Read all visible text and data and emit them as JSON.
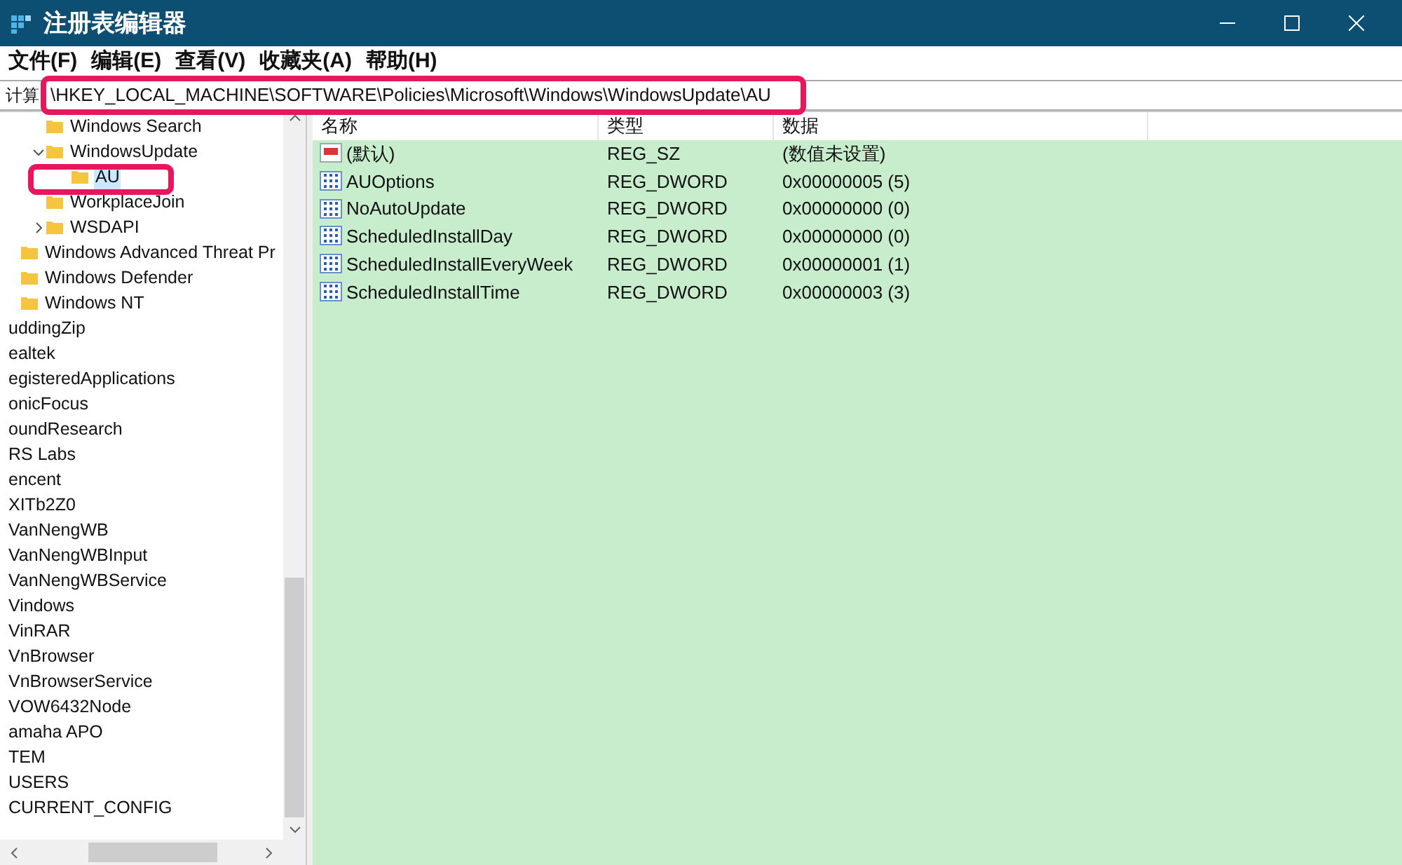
{
  "window": {
    "title": "注册表编辑器"
  },
  "menu": [
    "文件(F)",
    "编辑(E)",
    "查看(V)",
    "收藏夹(A)",
    "帮助(H)"
  ],
  "address": {
    "label": "计算",
    "value": "\\HKEY_LOCAL_MACHINE\\SOFTWARE\\Policies\\Microsoft\\Windows\\WindowsUpdate\\AU"
  },
  "tree": [
    {
      "children": [
        {
          "children": [
            {
              "label": "Windows Search",
              "selected": false
            },
            {
              "label": "WindowsUpdate",
              "selected": false,
              "expanded": true,
              "children": [
                {
                  "label": "AU",
                  "selected": true
                }
              ]
            },
            {
              "label": "WorkplaceJoin",
              "selected": false
            },
            {
              "label": "WSDAPI",
              "selected": false,
              "expanded": false
            }
          ]
        },
        {
          "label": "Windows Advanced Threat Pr",
          "selected": false
        },
        {
          "label": "Windows Defender",
          "selected": false
        },
        {
          "label": "Windows NT",
          "selected": false
        }
      ]
    },
    {
      "label": "uddingZip",
      "selected": false
    },
    {
      "label": "ealtek",
      "selected": false
    },
    {
      "label": "egisteredApplications",
      "selected": false
    },
    {
      "label": "onicFocus",
      "selected": false
    },
    {
      "label": "oundResearch",
      "selected": false
    },
    {
      "label": "RS Labs",
      "selected": false
    },
    {
      "label": "encent",
      "selected": false
    },
    {
      "label": "XITb2Z0",
      "selected": false
    },
    {
      "label": "VanNengWB",
      "selected": false
    },
    {
      "label": "VanNengWBInput",
      "selected": false
    },
    {
      "label": "VanNengWBService",
      "selected": false
    },
    {
      "label": "Vindows",
      "selected": false
    },
    {
      "label": "VinRAR",
      "selected": false
    },
    {
      "label": "VnBrowser",
      "selected": false
    },
    {
      "label": "VnBrowserService",
      "selected": false
    },
    {
      "label": "VOW6432Node",
      "selected": false
    },
    {
      "label": "amaha APO",
      "selected": false
    },
    {
      "label": "TEM",
      "selected": false
    },
    {
      "label": "USERS",
      "selected": false
    },
    {
      "label": "CURRENT_CONFIG",
      "selected": false
    }
  ],
  "table": {
    "columns": [
      "名称",
      "类型",
      "数据"
    ],
    "rows": [
      {
        "kind": "string",
        "name": "(默认)",
        "type": "REG_SZ",
        "data": "(数值未设置)"
      },
      {
        "kind": "dword",
        "name": "AUOptions",
        "type": "REG_DWORD",
        "data": "0x00000005 (5)"
      },
      {
        "kind": "dword",
        "name": "NoAutoUpdate",
        "type": "REG_DWORD",
        "data": "0x00000000 (0)"
      },
      {
        "kind": "dword",
        "name": "ScheduledInstallDay",
        "type": "REG_DWORD",
        "data": "0x00000000 (0)"
      },
      {
        "kind": "dword",
        "name": "ScheduledInstallEveryWeek",
        "type": "REG_DWORD",
        "data": "0x00000001 (1)"
      },
      {
        "kind": "dword",
        "name": "ScheduledInstallTime",
        "type": "REG_DWORD",
        "data": "0x00000003 (3)"
      }
    ]
  }
}
